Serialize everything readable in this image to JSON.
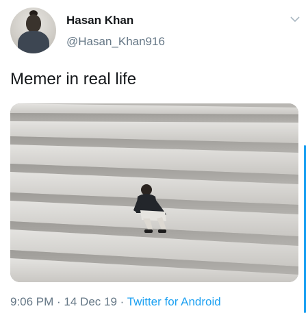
{
  "user": {
    "display_name": "Hasan Khan",
    "handle": "@Hasan_Khan916",
    "avatar_icon": "profile-photo"
  },
  "tweet": {
    "text": "Memer in real life",
    "media_icon": "photo-man-crouching-on-concrete-steps"
  },
  "meta": {
    "time": "9:06 PM",
    "separator": " · ",
    "date": "14 Dec 19",
    "source": "Twitter for Android"
  },
  "colors": {
    "accent": "#1da1f2",
    "secondary_text": "#657786",
    "primary_text": "#14171a"
  }
}
